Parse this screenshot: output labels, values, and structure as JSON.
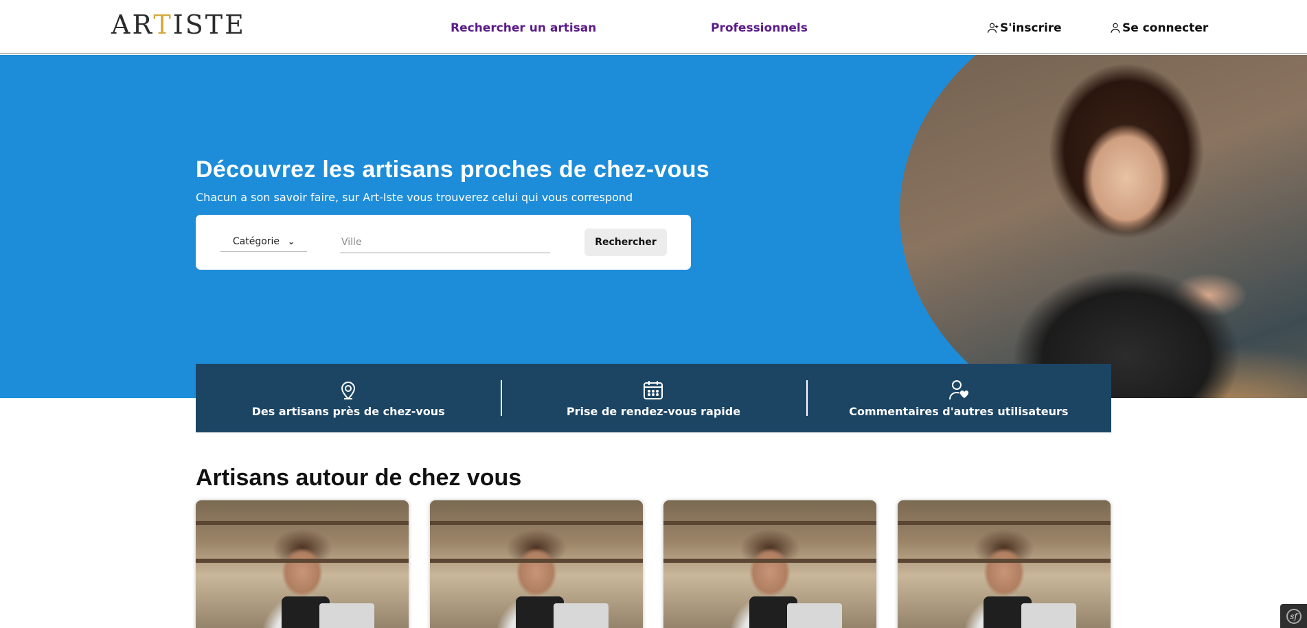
{
  "header": {
    "logo_text": "ARTISTE",
    "nav": {
      "find_artisan": "Rechercher un artisan",
      "professionals": "Professionnels"
    },
    "auth": {
      "register": "S'inscrire",
      "login": "Se connecter"
    }
  },
  "hero": {
    "title": "Découvrez les artisans proches de chez-vous",
    "subtitle": "Chacun a son savoir faire, sur Art-Iste vous trouverez celui qui vous correspond",
    "search": {
      "category_selected": "Catégorie",
      "city_placeholder": "Ville",
      "button_label": "Rechercher"
    }
  },
  "features": [
    {
      "icon": "map-pin-icon",
      "label": "Des artisans près de chez-vous"
    },
    {
      "icon": "calendar-icon",
      "label": "Prise de rendez-vous rapide"
    },
    {
      "icon": "user-heart-icon",
      "label": "Commentaires d'autres utilisateurs"
    }
  ],
  "section": {
    "title": "Artisans autour de chez vous"
  },
  "colors": {
    "hero_blue": "#1e8dd9",
    "features_navy": "#1c4564",
    "nav_purple": "#5b1d8a",
    "logo_gold": "#d4a93a"
  }
}
